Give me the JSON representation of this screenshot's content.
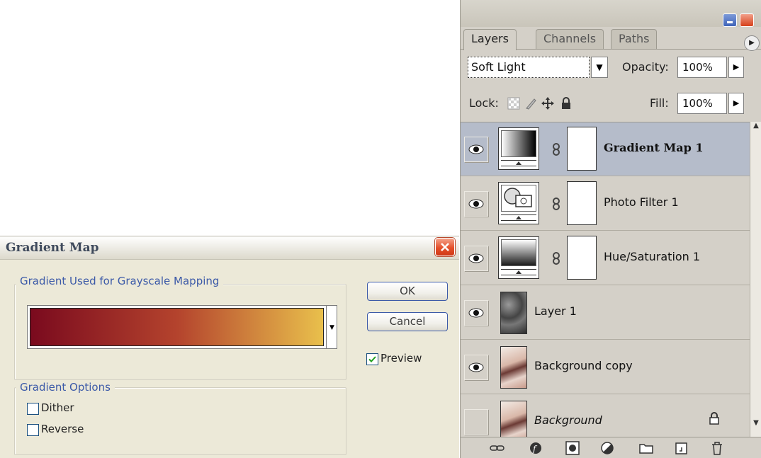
{
  "dialog": {
    "title": "Gradient Map",
    "group_gradient_label": "Gradient Used for Grayscale Mapping",
    "gradient_colors": [
      "#7a0a1e",
      "#b4432d",
      "#e9c04c"
    ],
    "group_options_label": "Gradient Options",
    "ok_label": "OK",
    "cancel_label": "Cancel",
    "preview_label": "Preview",
    "preview_checked": true,
    "dither_label": "Dither",
    "dither_checked": false,
    "reverse_label": "Reverse",
    "reverse_checked": false
  },
  "palette": {
    "tabs": [
      {
        "label": "Layers",
        "active": true
      },
      {
        "label": "Channels",
        "active": false
      },
      {
        "label": "Paths",
        "active": false
      }
    ],
    "blend_mode": "Soft Light",
    "opacity_label": "Opacity:",
    "opacity_value": "100%",
    "lock_label": "Lock:",
    "fill_label": "Fill:",
    "fill_value": "100%",
    "layers": [
      {
        "name": "Gradient Map 1",
        "visible": true,
        "selected": true,
        "kind": "gradient-map-adjustment"
      },
      {
        "name": "Photo Filter 1",
        "visible": true,
        "selected": false,
        "kind": "photo-filter-adjustment"
      },
      {
        "name": "Hue/Saturation 1",
        "visible": true,
        "selected": false,
        "kind": "hue-saturation-adjustment"
      },
      {
        "name": "Layer 1",
        "visible": true,
        "selected": false,
        "kind": "texture-layer"
      },
      {
        "name": "Background copy",
        "visible": true,
        "selected": false,
        "kind": "photo-layer"
      },
      {
        "name": "Background",
        "visible": false,
        "selected": false,
        "kind": "photo-layer",
        "locked": true
      }
    ],
    "footer_icons": [
      "link-layers-icon",
      "layer-style-icon",
      "layer-mask-icon",
      "adjustment-layer-icon",
      "new-group-icon",
      "new-layer-icon",
      "delete-layer-icon"
    ]
  }
}
